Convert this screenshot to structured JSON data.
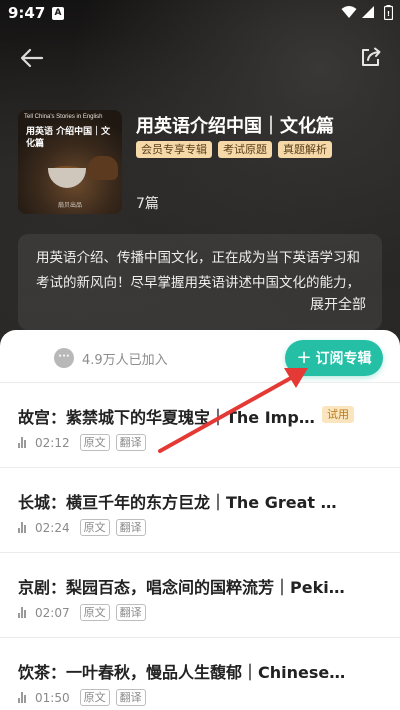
{
  "status_bar": {
    "time": "9:47",
    "notification_badge": "A"
  },
  "album": {
    "cover_top_text": "Tell China's Stories in English",
    "cover_title": "用英语 介绍中国｜文化篇",
    "cover_publisher": "扇贝出品",
    "title": "用英语介绍中国｜文化篇",
    "tags": [
      "会员专享专辑",
      "考试原题",
      "真题解析"
    ],
    "count": "7篇",
    "description": "用英语介绍、传播中国文化，正在成为当下英语学习和考试的新风向！尽早掌握用英语讲述中国文化的能力，",
    "expand_label": "展开全部"
  },
  "sheet": {
    "joined_text": "4.9万人已加入",
    "subscribe_label": "订阅专辑",
    "items": [
      {
        "title": "故宫：紫禁城下的华夏瑰宝｜The Impe…",
        "trial": "试用",
        "duration": "02:12",
        "tag1": "原文",
        "tag2": "翻译"
      },
      {
        "title": "长城：横亘千年的东方巨龙｜The Great Wall",
        "duration": "02:24",
        "tag1": "原文",
        "tag2": "翻译"
      },
      {
        "title": "京剧：梨园百态，唱念间的国粹流芳｜Peki…",
        "duration": "02:07",
        "tag1": "原文",
        "tag2": "翻译"
      },
      {
        "title": "饮茶：一叶春秋，慢品人生馥郁｜Chinese T…",
        "duration": "01:50",
        "tag1": "原文",
        "tag2": "翻译"
      }
    ]
  },
  "colors": {
    "accent": "#25bfa6",
    "tag_bg": "#f6d9a8",
    "arrow": "#e53935"
  },
  "icons": {
    "back": "arrow-left-icon",
    "share": "share-icon",
    "more": "dots-icon",
    "plus": "plus-icon",
    "audio": "audio-bars-icon"
  }
}
